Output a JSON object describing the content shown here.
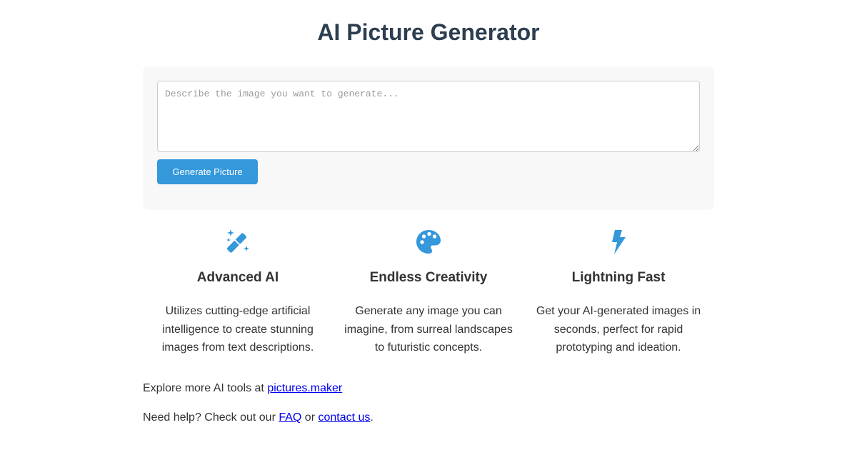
{
  "page": {
    "title": "AI Picture Generator"
  },
  "generator": {
    "prompt_value": "",
    "prompt_placeholder": "Describe the image you want to generate...",
    "button_label": "Generate Picture"
  },
  "features": [
    {
      "icon": "magic-wand-sparkles-icon",
      "title": "Advanced AI",
      "description": "Utilizes cutting-edge artificial intelligence to create stunning images from text descriptions."
    },
    {
      "icon": "palette-icon",
      "title": "Endless Creativity",
      "description": "Generate any image you can imagine, from surreal landscapes to futuristic concepts."
    },
    {
      "icon": "lightning-bolt-icon",
      "title": "Lightning Fast",
      "description": "Get your AI-generated images in seconds, perfect for rapid prototyping and ideation."
    }
  ],
  "footer": {
    "explore_prefix": "Explore more AI tools at ",
    "explore_link": "pictures.maker",
    "help_prefix": "Need help? Check out our ",
    "faq_link": "FAQ",
    "help_middle": " or ",
    "contact_link": "contact us",
    "help_suffix": "."
  },
  "colors": {
    "accent": "#3498db",
    "title": "#2c3e50",
    "text": "#333333",
    "card_background": "#f8f8f8",
    "link": "#0000ee"
  }
}
